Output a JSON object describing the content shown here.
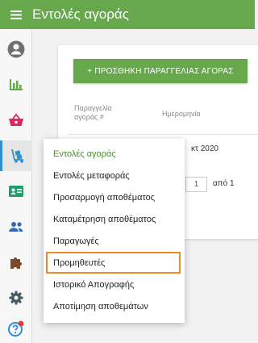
{
  "header": {
    "title": "Εντολές αγοράς",
    "menu_icon": "hamburger-menu-icon"
  },
  "sidebar": {
    "items": [
      {
        "icon": "user-account-icon",
        "color": "#707070"
      },
      {
        "icon": "bar-chart-icon",
        "color": "#66a84b"
      },
      {
        "icon": "shopping-basket-icon",
        "color": "#e0245e"
      },
      {
        "icon": "hand-truck-icon",
        "color": "#2f8fd0",
        "active": true
      },
      {
        "icon": "contact-card-icon",
        "color": "#1e9e6a"
      },
      {
        "icon": "people-icon",
        "color": "#3567b5"
      },
      {
        "icon": "puzzle-icon",
        "color": "#7a4a2a"
      },
      {
        "icon": "gear-icon",
        "color": "#455a64"
      },
      {
        "icon": "help-icon",
        "color": "#2f8fd0",
        "badge_color": "#e53935"
      }
    ]
  },
  "main": {
    "add_button_label": "+ ΠΡΟΣΘΗΚΗ ΠΑΡΑΓΓΕΛΙΑΣ ΑΓΟΡΑΣ",
    "columns": {
      "order_number": "Παραγγελία αγοράς #",
      "date": "Ημερομηνία"
    },
    "row_date_fragment": "κτ 2020",
    "pagination": {
      "current_page": "1",
      "of_label": "από 1"
    }
  },
  "dropdown": {
    "items": [
      {
        "label": "Εντολές αγοράς",
        "active": true
      },
      {
        "label": "Εντολές μεταφοράς"
      },
      {
        "label": "Προσαρμογή αποθέματος"
      },
      {
        "label": "Καταμέτρηση αποθέματος"
      },
      {
        "label": "Παραγωγές"
      },
      {
        "label": "Προμηθευτές",
        "highlighted": true
      },
      {
        "label": "Ιστορικό Απογραφής"
      },
      {
        "label": "Αποτίμηση αποθεμάτων"
      }
    ]
  },
  "colors": {
    "brand_green": "#66a84b",
    "highlight_orange": "#f08a24",
    "active_blue": "#2f8fd0"
  }
}
